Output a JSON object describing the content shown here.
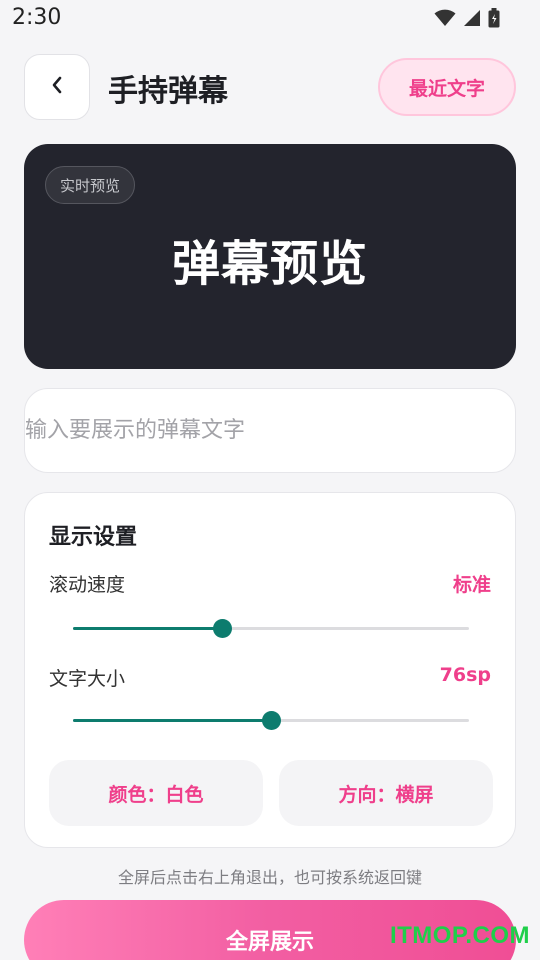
{
  "status_bar": {
    "time": "2:30",
    "icons": [
      "wifi-icon",
      "signal-icon",
      "battery-icon"
    ]
  },
  "header": {
    "back_icon": "chevron-left-icon",
    "title": "手持弹幕",
    "recent_label": "最近文字"
  },
  "preview": {
    "badge": "实时预览",
    "text": "弹幕预览"
  },
  "input": {
    "placeholder": "输入要展示的弹幕文字",
    "value": ""
  },
  "settings": {
    "title": "显示设置",
    "speed": {
      "label": "滚动速度",
      "value": "标准",
      "level": 0.375
    },
    "size": {
      "label": "文字大小",
      "value": "76sp",
      "level": 0.5
    },
    "color_button": "颜色：白色",
    "direction_button": "方向：横屏"
  },
  "hint": "全屏后点击右上角退出，也可按系统返回键",
  "fullscreen_button": "全屏展示",
  "watermark": "ITMOP.COM",
  "colors": {
    "accent_pink": "#ef3f8b",
    "slider_green": "#0d7c6e",
    "preview_bg": "#23242d"
  }
}
